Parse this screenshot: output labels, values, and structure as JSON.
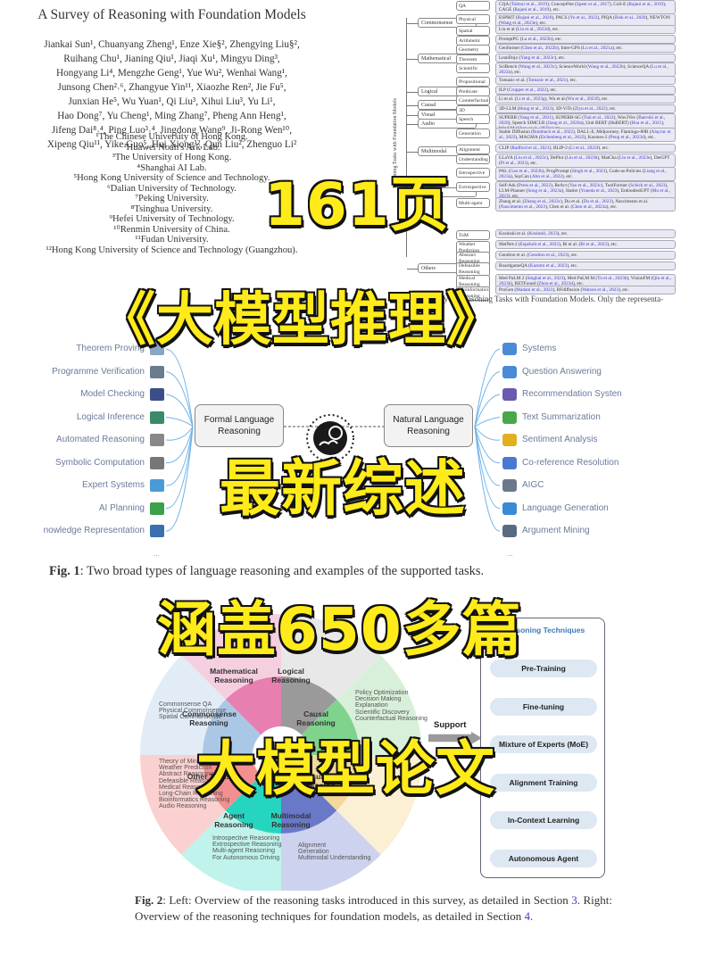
{
  "paper": {
    "title": "A Survey of Reasoning with Foundation Models",
    "authors": [
      "Jiankai Sun¹,  Chuanyang Zheng¹,  Enze Xie§²,  Zhengying Liu§²,",
      "Ruihang Chu¹,  Jianing Qiu¹,  Jiaqi Xu¹,  Mingyu Ding³,",
      "Hongyang Li⁴,  Mengzhe Geng¹,  Yue Wu²,  Wenhai Wang¹,",
      "Junsong Chen²˒⁶,  Zhangyue Yin¹¹,  Xiaozhe Ren²,  Jie Fu⁵,",
      "Junxian He⁵,  Wu Yuan¹,  Qi Liu³,  Xihui Liu³,  Yu Li¹,",
      "Hao Dong⁷,  Yu Cheng¹,  Ming Zhang⁷,  Pheng Ann Heng¹,",
      "Jifeng Dai⁸˒⁴,  Ping Luo³˒⁴,  Jingdong Wang⁹,  Ji-Rong Wen¹⁰,",
      "Xipeng Qiu¹¹,  Yike Guo⁵,  Hui Xiong¹²,  Qun Liu²,  Zhenguo Li²"
    ],
    "affiliations": [
      "¹The Chinese University of Hong Kong.",
      "²Huawei Noah's Ark Lab.",
      "³The University of Hong Kong.",
      "⁴Shanghai AI Lab.",
      "⁵Hong Kong University of Science and Technology.",
      "⁶Dalian University of Technology.",
      "⁷Peking University.",
      "⁸Tsinghua University.",
      "⁹Hefei University of Technology.",
      "¹⁰Renmin University of China.",
      "¹¹Fudan University.",
      "¹²Hong Kong University of Science and Technology (Guangzhou)."
    ]
  },
  "taxonomy": {
    "root_label": "Reasoning Tasks with Foundation Models",
    "categories": [
      {
        "label": "Commonsense"
      },
      {
        "label": "Mathematical"
      },
      {
        "label": "Logical"
      },
      {
        "label": "Causal"
      },
      {
        "label": "Visual"
      },
      {
        "label": "Audio"
      },
      {
        "label": "Multimodal"
      },
      {
        "label": "Agent"
      },
      {
        "label": "Others"
      }
    ],
    "subcategories": [
      {
        "label": "QA",
        "leaf": "CQA (Talmor et al., 2019), ConceptNet (Speer et al., 2017), CoS-E (Rajani et al., 2019), CAGE (Rajani et al., 2019), etc."
      },
      {
        "label": "Physical",
        "leaf": "ESPRIT (Rajani et al., 2020), PACS (Yu et al., 2022), PIQA (Bisk et al., 2020), NEWTON (Wang et al., 2023e), etc."
      },
      {
        "label": "Spatial",
        "leaf": "Liu et al (Liu et al., 2022d), etc."
      },
      {
        "label": "Arithmetic",
        "leaf": "PromptPG (Lu et al., 2022b), etc."
      },
      {
        "label": "Geometry",
        "leaf": "Geoformer (Chen et al., 2022b), Inter-GPS (Lu et al., 2021a), etc."
      },
      {
        "label": "Theorem",
        "leaf": "LeanDojo (Yang et al., 2023c), etc."
      },
      {
        "label": "Scientific",
        "leaf": "SciBench (Wang et al., 2023c), ScienceWorld (Wang et al., 2022b), ScienceQA (Lu et al., 2022a), etc."
      },
      {
        "label": "Propositional",
        "leaf": "Tomasic et al. (Tomasic et al., 2021), etc."
      },
      {
        "label": "Predicate",
        "leaf": "ILP (Cropper et al., 2022), etc."
      },
      {
        "label": "Counterfactual",
        "leaf": "Li et al. (Li et al., 2023g), Wu et al.(Wu et al., 2023f), etc."
      },
      {
        "label": "3D",
        "leaf": "3D-LLM (Hong et al., 2023), 3D-ViTs (Ziyu et al., 2022), etc."
      },
      {
        "label": "Speech",
        "leaf": "SUPERB (Yang et al., 2021), SUPERB-SG (Tsai et al., 2022), Wav2Vec (Baevski et al., 2020), Speech SIMCLR (Jiang et al., 2020a), Unit BERT (HuBERT) (Hsu et al., 2021), WavLM (Chen et al., 2022c) etc."
      },
      {
        "label": "Generation",
        "leaf": "Stable Diffusion (Rombach et al., 2022), DALL-E, Midjourney, Flamingo-80B (Alayrac et al., 2022), MAGMA (Eichenberg et al., 2022), Kosmos-2 (Peng et al., 2023d), etc."
      },
      {
        "label": "Alignment",
        "leaf": "CLIP (Radford et al., 2021), BLIP-2 (Li et al., 2023f), etc."
      },
      {
        "label": "Understanding",
        "leaf": "LLaVA (Liu et al., 2023c), DePlot (Liu et al., 2023b), MatCha (Liu et al., 2023e), DetGPT (Pi et al., 2023), etc."
      },
      {
        "label": "Introspective",
        "leaf": "PAL (Gao et al., 2022b), ProgPrompt (Singh et al., 2023), Code-as-Policies (Liang et al., 2023a), SayCan (Ahn et al., 2022), etc."
      },
      {
        "label": "Extrospective",
        "leaf": "Self-Ask (Press et al., 2022), ReAct (Yao et al., 2023c), ToolFormer (Schick et al., 2023), LLM-Planner (Song et al., 2023a), Statler (Yoneda et al., 2023), EmbodiedGPT (Mu et al., 2023), etc."
      },
      {
        "label": "Multi-agent",
        "leaf": "Zhang et al. (Zhang et al., 2023c), Du et al. (Du et al., 2023), Nascimento et al. (Nascimento et al., 2023), Chen et al. (Chen et al., 2023a), etc."
      },
      {
        "label": "ToM",
        "leaf": "Kosinski et al. (Kosinski, 2023), etc."
      },
      {
        "label": "Weather Prediction",
        "leaf": "MetNet-2 (Espeholt et al., 2022), Bi et al. (Bi et al., 2023), etc."
      },
      {
        "label": "Abstract Reasoning",
        "leaf": "Gendron et al. (Gendron et al., 2023), etc."
      },
      {
        "label": "Defeasible Reasoning",
        "leaf": "BoardgameQA (Kazemi et al., 2023), etc."
      },
      {
        "label": "Medical Reasoning",
        "leaf": "Med PaLM 2 (Singhal et al., 2023), Med PaLM M (Tu et al., 2023b), VisionFM (Qiu et al., 2023b), RETFound (Zhou et al., 2023d), etc."
      },
      {
        "label": "Bioinformatics Reasoning",
        "leaf": "ProGen (Madani et al., 2023), RFdiffusion (Watson et al., 2023), etc."
      }
    ],
    "caption": "Fig. 5: Taxonomy of Reasoning Tasks with Foundation Models. Only the representa-"
  },
  "fig1": {
    "left_box": "Formal Language Reasoning",
    "right_box": "Natural Language Reasoning",
    "left_items": [
      "Theorem Proving",
      "Programme Verification",
      "Model Checking",
      "Logical Inference",
      "Automated Reasoning",
      "Symbolic Computation",
      "Expert Systems",
      "AI Planning",
      "nowledge Representation"
    ],
    "right_items": [
      "Systems",
      "Question Answering",
      "Recommendation Systen",
      "Text Summarization",
      "Sentiment Analysis",
      "Co-reference Resolution",
      "AIGC",
      "Language Generation",
      "Argument Mining"
    ],
    "ellipsis": "...",
    "caption_label": "Fig. 1",
    "caption_text": ": Two broad types of language reasoning and examples of the supported tasks."
  },
  "fig2": {
    "wheel_segments": [
      {
        "label": "Mathematical Reasoning",
        "color": "#e77fb1"
      },
      {
        "label": "Logical Reasoning",
        "color": "#9a9a9a"
      },
      {
        "label": "Causal Reasoning",
        "color": "#7fd38c"
      },
      {
        "label": "Visual Reasoning",
        "color": "#f3d99a"
      },
      {
        "label": "Multimodal Reasoning",
        "color": "#6a78c8"
      },
      {
        "label": "Agent Reasoning",
        "color": "#26d5c0"
      },
      {
        "label": "Other Tasks",
        "color": "#f28f8f"
      },
      {
        "label": "Commonsense Reasoning",
        "color": "#aac8e6"
      }
    ],
    "commonsense_items": [
      "Commonsense QA",
      "Physical Commonsense",
      "Spatial Commonsense"
    ],
    "causal_items": [
      "Policy Optimization",
      "Decision Making",
      "Explanation",
      "Scientific Discovery",
      "Counterfactual Reasoning"
    ],
    "other_items": [
      "Theory of Mind",
      "Weather Prediction",
      "Abstract Reasoning",
      "Defeasible Reasoning",
      "Medical Reasoning",
      "Long-Chain Reasoning",
      "Bioinformatics Reasoning",
      "Audio Reasoning"
    ],
    "agent_items": [
      "Introspective Reasoning",
      "Extrospective Reasoning",
      "Multi-agent Reasoning",
      "For Autonomous Driving"
    ],
    "multimodal_items": [
      "Alignment",
      "Generation",
      "Multimodal Understanding"
    ],
    "support_label": "Support",
    "tech_title": "Reasoning Techniques",
    "techniques": [
      "Pre-Training",
      "Fine-tuning",
      "Mixture of Experts (MoE)",
      "Alignment Training",
      "In-Context Learning",
      "Autonomous Agent"
    ],
    "caption_label": "Fig. 2",
    "caption_p1": ": Left: Overview of the reasoning tasks introduced in this survey, as detailed in Section ",
    "caption_ref1": "3",
    "caption_p2": ". Right: Overview of the reasoning techniques for foundation models, as detailed in Section ",
    "caption_ref2": "4",
    "caption_p3": "."
  },
  "overlay": {
    "line1": "161页",
    "line2": "《大模型推理》",
    "line3": "最新综述",
    "line4": "涵盖650多篇",
    "line5": "大模型论文"
  }
}
